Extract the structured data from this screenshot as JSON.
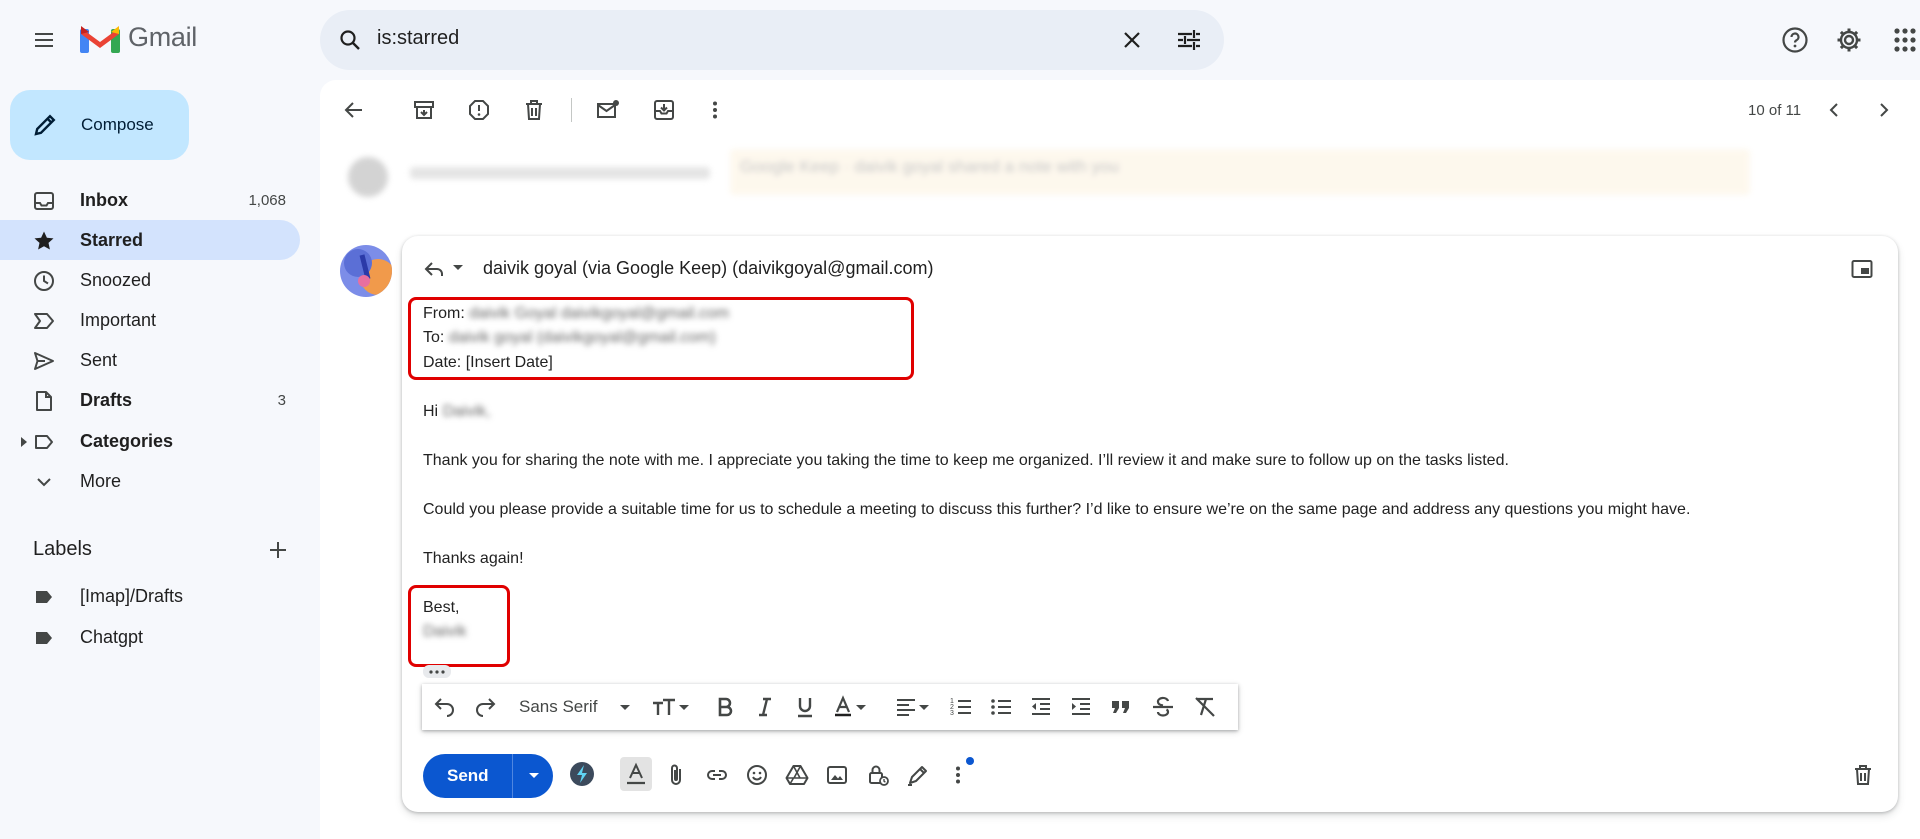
{
  "app": {
    "name": "Gmail"
  },
  "search": {
    "query": "is:starred"
  },
  "compose": {
    "label": "Compose"
  },
  "sidebar": {
    "items": [
      {
        "label": "Inbox",
        "count": "1,068"
      },
      {
        "label": "Starred",
        "count": ""
      },
      {
        "label": "Snoozed",
        "count": ""
      },
      {
        "label": "Important",
        "count": ""
      },
      {
        "label": "Sent",
        "count": ""
      },
      {
        "label": "Drafts",
        "count": "3"
      },
      {
        "label": "Categories",
        "count": ""
      },
      {
        "label": "More",
        "count": ""
      }
    ],
    "labels_header": "Labels",
    "labels": [
      "[Imap]/Drafts",
      "Chatgpt"
    ]
  },
  "toolbar": {
    "pager": "10 of 11"
  },
  "previous_message": {
    "snippet": "Google Keep · daivik goyal shared a note with you"
  },
  "draft": {
    "recipient": "daivik goyal (via Google Keep) (daivikgoyal@gmail.com)",
    "from_label": "From:",
    "from_value": "daivik Goyal daivikgoyal@gmail.com",
    "to_label": "To:",
    "to_value": "daivik goyal (daivikgoyal@gmail.com)",
    "date_line": "Date: [Insert Date]",
    "greeting": "Hi",
    "greeting_name": "Daivik,",
    "paragraph1": "Thank you for sharing the note with me. I appreciate you taking the time to keep me organized. I’ll review it and make sure to follow up on the tasks listed.",
    "paragraph2": "Could you please provide a suitable time for us to schedule a meeting to discuss this further? I’d like to ensure we’re on the same page and address any questions you might have.",
    "thanks": "Thanks again!",
    "signoff": "Best,",
    "signature": "Daivik"
  },
  "format": {
    "font": "Sans Serif"
  },
  "send": {
    "label": "Send"
  },
  "colors": {
    "accent": "#0b57d0",
    "compose_bg": "#c2e7ff",
    "active_nav": "#d3e3fd",
    "highlight": "#e00000"
  }
}
